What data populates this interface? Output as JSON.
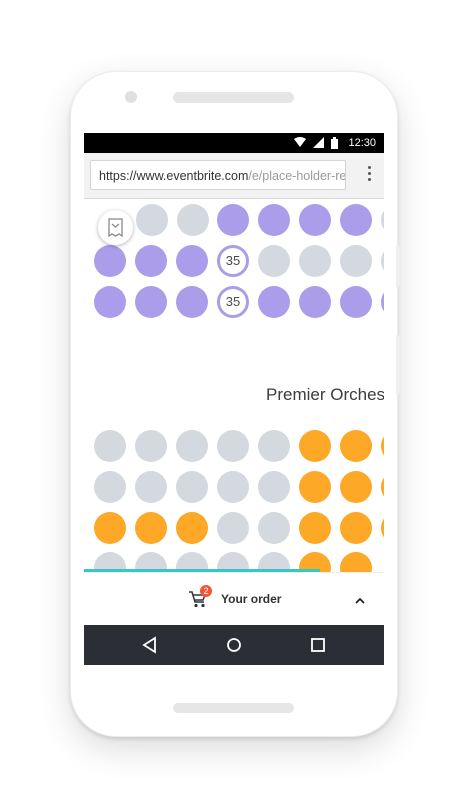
{
  "status_bar": {
    "time": "12:30"
  },
  "browser": {
    "url_main": "https://www.eventbrite.com",
    "url_path": "/e/place-holder-re"
  },
  "seat_map": {
    "section_label": "Premier Orches",
    "selected_seat_number": "35"
  },
  "order_bar": {
    "label": "Your order",
    "cart_count": "2"
  },
  "colors": {
    "available_seat": "#ab9de9",
    "premier_seat": "#fda826",
    "unavailable_seat": "#d4d8df",
    "progress": "#36c8c6",
    "badge": "#f05537"
  },
  "icons": [
    "wifi-icon",
    "signal-icon",
    "battery-icon",
    "menu-dots-icon",
    "ticket-icon",
    "cart-icon",
    "chevron-up-icon",
    "back-icon",
    "home-icon",
    "recents-icon"
  ]
}
